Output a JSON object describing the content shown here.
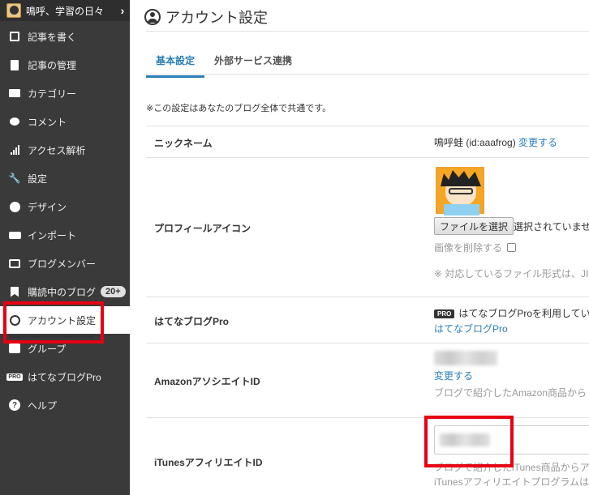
{
  "sidebar": {
    "blog_name": "鳴呼、学習の日々",
    "items": [
      {
        "label": "記事を書く",
        "icon": "pencil-icon"
      },
      {
        "label": "記事の管理",
        "icon": "document-icon"
      },
      {
        "label": "カテゴリー",
        "icon": "folder-icon"
      },
      {
        "label": "コメント",
        "icon": "comment-icon"
      },
      {
        "label": "アクセス解析",
        "icon": "bar-chart-icon"
      },
      {
        "label": "設定",
        "icon": "wrench-icon"
      },
      {
        "label": "デザイン",
        "icon": "palette-icon"
      },
      {
        "label": "インポート",
        "icon": "truck-icon"
      },
      {
        "label": "ブログメンバー",
        "icon": "member-card-icon"
      },
      {
        "label": "購読中のブログ",
        "icon": "bookmark-icon",
        "badge": "20+"
      },
      {
        "label": "アカウント設定",
        "icon": "user-icon",
        "active": true
      },
      {
        "label": "グループ",
        "icon": "group-icon"
      },
      {
        "label": "はてなブログPro",
        "icon": "pro-icon"
      },
      {
        "label": "ヘルプ",
        "icon": "help-icon"
      }
    ]
  },
  "main": {
    "title": "アカウント設定",
    "tabs": [
      {
        "label": "基本設定",
        "active": true
      },
      {
        "label": "外部サービス連携",
        "active": false
      }
    ],
    "note": "※この設定はあなたのブログ全体で共通です。",
    "rows": {
      "nickname": {
        "label": "ニックネーム",
        "value": "鳴呼蛙 (id:aaafrog)",
        "change_link": "変更する"
      },
      "profile_icon": {
        "label": "プロフィールアイコン",
        "file_button": "ファイルを選択",
        "file_status": "選択されていませ",
        "delete_label": "画像を削除する",
        "formats_note": "※ 対応しているファイル形式は、JI"
      },
      "pro": {
        "label": "はてなブログPro",
        "badge": "PRO",
        "text": "はてなブログProを利用してい",
        "link": "はてなブログPro"
      },
      "amazon": {
        "label": "AmazonアソシエイトID",
        "change_link": "変更する",
        "desc": "ブログで紹介したAmazon商品から"
      },
      "itunes": {
        "label": "iTunesアフィリエイトID",
        "desc1": "ブログで紹介したiTunes商品からア",
        "desc2": "iTunesアフィリエイトプログラムは"
      }
    }
  },
  "colors": {
    "sidebar_bg": "#3a3a3a",
    "accent_blue": "#2b7fb8",
    "highlight_red": "#e60012"
  }
}
